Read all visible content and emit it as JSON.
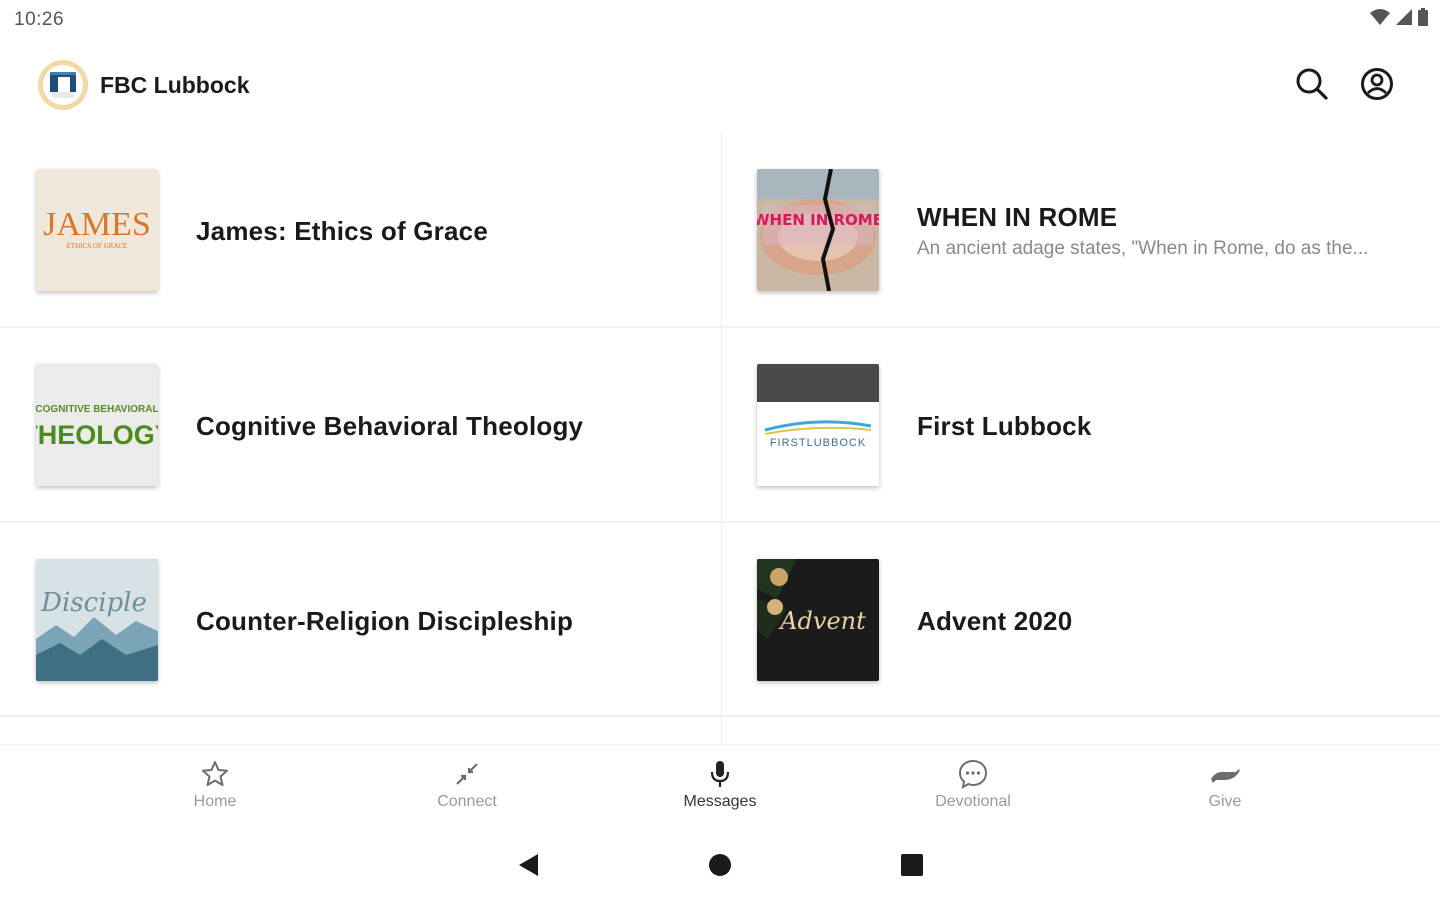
{
  "status_bar": {
    "time": "10:26"
  },
  "app_bar": {
    "title": "FBC Lubbock",
    "search_icon": "search-icon",
    "account_icon": "account-circle-icon"
  },
  "cards": [
    {
      "title": "James: Ethics of Grace",
      "subtitle": "",
      "thumb_title": "JAMES",
      "thumb_sub": "ETHICS OF GRACE"
    },
    {
      "title": "WHEN IN ROME",
      "subtitle": "An ancient adage states, \"When in Rome, do as the...",
      "thumb_title": "WHEN IN ROME",
      "thumb_sub": ""
    },
    {
      "title": "Cognitive Behavioral Theology",
      "subtitle": "",
      "thumb_title": "THEOLOGY",
      "thumb_sub": "COGNITIVE BEHAVIORAL"
    },
    {
      "title": "First Lubbock",
      "subtitle": "",
      "thumb_title": "FIRSTLUBBOCK",
      "thumb_sub": ""
    },
    {
      "title": "Counter-Religion Discipleship",
      "subtitle": "",
      "thumb_title": "Disciple",
      "thumb_sub": ""
    },
    {
      "title": "Advent 2020",
      "subtitle": "",
      "thumb_title": "Advent",
      "thumb_sub": ""
    }
  ],
  "bottom_nav": [
    {
      "label": "Home",
      "icon": "star-icon"
    },
    {
      "label": "Connect",
      "icon": "connect-arrows-icon"
    },
    {
      "label": "Messages",
      "icon": "microphone-icon",
      "active": true
    },
    {
      "label": "Devotional",
      "icon": "chat-bubble-icon"
    },
    {
      "label": "Give",
      "icon": "give-hand-icon"
    }
  ],
  "colors": {
    "text_primary": "#1a1a1a",
    "text_secondary": "#8a8a8a",
    "nav_inactive": "#9a9a9a",
    "divider": "#ececec"
  }
}
